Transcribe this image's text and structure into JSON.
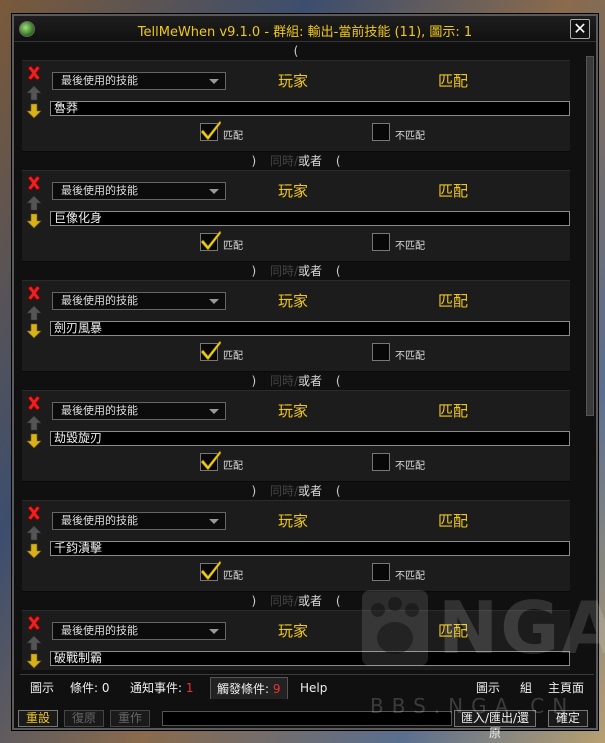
{
  "window": {
    "title": "TellMeWhen v9.1.0  - 群組: 輸出-當前技能 (11), 圖示: 1",
    "close_label": "✕"
  },
  "list": {
    "lead_paren": "(",
    "connector": {
      "close_paren": ")",
      "and_label": "同時",
      "separator": "/",
      "or_label": "或者",
      "open_paren": "("
    },
    "conditions": [
      {
        "type_label": "最後使用的技能",
        "unit_label": "玩家",
        "op_label": "匹配",
        "name": "魯莽",
        "match_label": "匹配",
        "nomatch_label": "不匹配"
      },
      {
        "type_label": "最後使用的技能",
        "unit_label": "玩家",
        "op_label": "匹配",
        "name": "巨像化身",
        "match_label": "匹配",
        "nomatch_label": "不匹配"
      },
      {
        "type_label": "最後使用的技能",
        "unit_label": "玩家",
        "op_label": "匹配",
        "name": "劍刃風暴",
        "match_label": "匹配",
        "nomatch_label": "不匹配"
      },
      {
        "type_label": "最後使用的技能",
        "unit_label": "玩家",
        "op_label": "匹配",
        "name": "劫毀旋刃",
        "match_label": "匹配",
        "nomatch_label": "不匹配"
      },
      {
        "type_label": "最後使用的技能",
        "unit_label": "玩家",
        "op_label": "匹配",
        "name": "千鈞潰擊",
        "match_label": "匹配",
        "nomatch_label": "不匹配"
      },
      {
        "type_label": "最後使用的技能",
        "unit_label": "玩家",
        "op_label": "匹配",
        "name": "破戰制霸",
        "match_label": "匹配",
        "nomatch_label": "不匹配"
      }
    ]
  },
  "tabs": {
    "icon": "圖示",
    "conditions_label": "條件: ",
    "conditions_count": "0",
    "notify_label": "通知事件: ",
    "notify_count": "1",
    "trigger_label": "觸發條件: ",
    "trigger_count": "9",
    "help": "Help",
    "right_icon": "圖示",
    "right_group": "組",
    "right_main": "主頁面"
  },
  "bottom": {
    "reset": "重設",
    "restore": "復原",
    "redo": "重作",
    "import_export": "匯入/匯出/還原",
    "ok": "確定"
  },
  "watermark": {
    "text": "NGA",
    "sub": "BBS.NGA.CN"
  },
  "colors": {
    "accent_gold": "#f0c818",
    "count_red": "#e33333",
    "check_yellow": "#f2d21a"
  }
}
